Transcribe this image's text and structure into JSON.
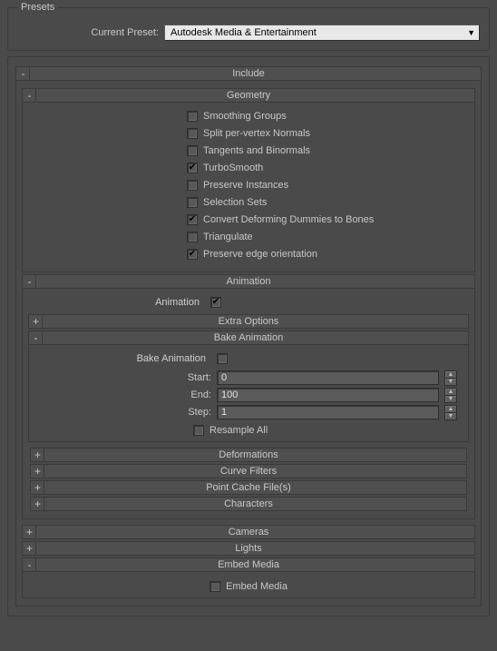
{
  "presets": {
    "group_label": "Presets",
    "current_label": "Current Preset:",
    "current_value": "Autodesk Media & Entertainment"
  },
  "include": {
    "title": "Include",
    "geometry": {
      "title": "Geometry",
      "items": [
        {
          "label": "Smoothing Groups",
          "checked": false
        },
        {
          "label": "Split per-vertex Normals",
          "checked": false
        },
        {
          "label": "Tangents and Binormals",
          "checked": false
        },
        {
          "label": "TurboSmooth",
          "checked": true
        },
        {
          "label": "Preserve Instances",
          "checked": false
        },
        {
          "label": "Selection Sets",
          "checked": false
        },
        {
          "label": "Convert Deforming Dummies to Bones",
          "checked": true
        },
        {
          "label": "Triangulate",
          "checked": false
        },
        {
          "label": "Preserve edge orientation",
          "checked": true
        }
      ]
    },
    "animation": {
      "title": "Animation",
      "anim_label": "Animation",
      "anim_checked": true,
      "extra_options": {
        "title": "Extra Options"
      },
      "bake": {
        "title": "Bake Animation",
        "bake_label": "Bake Animation",
        "bake_checked": false,
        "start_label": "Start:",
        "start_value": "0",
        "end_label": "End:",
        "end_value": "100",
        "step_label": "Step:",
        "step_value": "1",
        "resample_label": "Resample All",
        "resample_checked": false
      },
      "deformations": {
        "title": "Deformations"
      },
      "curve_filters": {
        "title": "Curve Filters"
      },
      "point_cache": {
        "title": "Point Cache File(s)"
      },
      "characters": {
        "title": "Characters"
      }
    },
    "cameras": {
      "title": "Cameras"
    },
    "lights": {
      "title": "Lights"
    },
    "embed": {
      "title": "Embed Media",
      "embed_label": "Embed Media",
      "embed_checked": false
    }
  }
}
